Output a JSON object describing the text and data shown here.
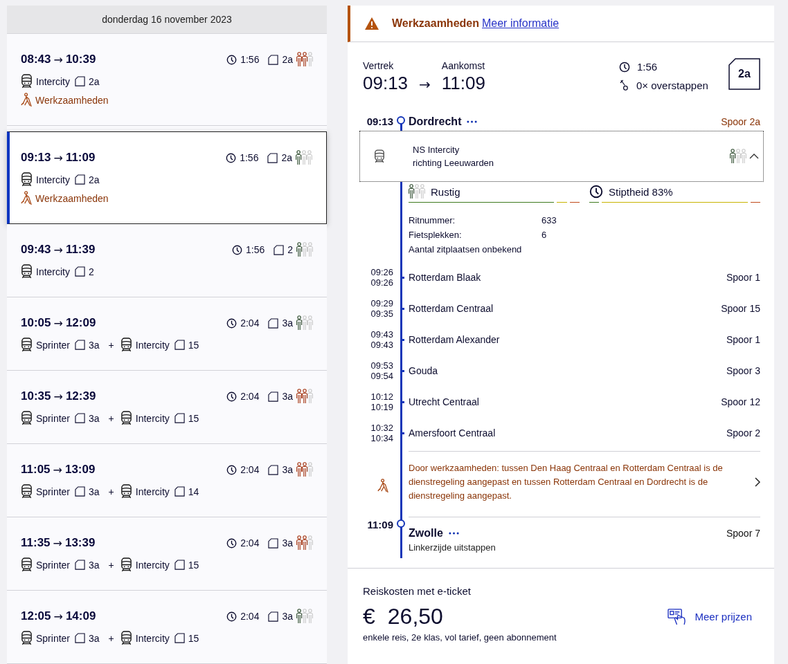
{
  "date_header": "donderdag 16 november 2023",
  "trips": [
    {
      "depart": "08:43",
      "arrow": "→",
      "arrive": "10:39",
      "selected": false,
      "duration": "1:56",
      "platform": "2a",
      "busy": true,
      "legs": [
        {
          "type": "Intercity",
          "platform": "2a"
        }
      ],
      "notice": "Werkzaamheden"
    },
    {
      "depart": "09:13",
      "arrow": "→",
      "arrive": "11:09",
      "selected": true,
      "duration": "1:56",
      "platform": "2a",
      "busy": false,
      "legs": [
        {
          "type": "Intercity",
          "platform": "2a"
        }
      ],
      "notice": "Werkzaamheden"
    },
    {
      "depart": "09:43",
      "arrow": "→",
      "arrive": "11:39",
      "selected": false,
      "duration": "1:56",
      "platform": "2",
      "busy": false,
      "legs": [
        {
          "type": "Intercity",
          "platform": "2"
        }
      ]
    },
    {
      "depart": "10:05",
      "arrow": "→",
      "arrive": "12:09",
      "selected": false,
      "duration": "2:04",
      "platform": "3a",
      "busy": false,
      "leg_separator": "+",
      "legs": [
        {
          "type": "Sprinter",
          "platform": "3a"
        },
        {
          "type": "Intercity",
          "platform": "15"
        }
      ]
    },
    {
      "depart": "10:35",
      "arrow": "→",
      "arrive": "12:39",
      "selected": false,
      "duration": "2:04",
      "platform": "3a",
      "busy": true,
      "leg_separator": "+",
      "legs": [
        {
          "type": "Sprinter",
          "platform": "3a"
        },
        {
          "type": "Intercity",
          "platform": "15"
        }
      ]
    },
    {
      "depart": "11:05",
      "arrow": "→",
      "arrive": "13:09",
      "selected": false,
      "duration": "2:04",
      "platform": "3a",
      "busy": true,
      "leg_separator": "+",
      "legs": [
        {
          "type": "Sprinter",
          "platform": "3a"
        },
        {
          "type": "Intercity",
          "platform": "14"
        }
      ]
    },
    {
      "depart": "11:35",
      "arrow": "→",
      "arrive": "13:39",
      "selected": false,
      "duration": "2:04",
      "platform": "3a",
      "busy": true,
      "leg_separator": "+",
      "legs": [
        {
          "type": "Sprinter",
          "platform": "3a"
        },
        {
          "type": "Intercity",
          "platform": "15"
        }
      ]
    },
    {
      "depart": "12:05",
      "arrow": "→",
      "arrive": "14:09",
      "selected": false,
      "duration": "2:04",
      "platform": "3a",
      "busy": false,
      "leg_separator": "+",
      "legs": [
        {
          "type": "Sprinter",
          "platform": "3a"
        },
        {
          "type": "Intercity",
          "platform": "15"
        }
      ]
    }
  ],
  "detail": {
    "alert": {
      "title": "Werkzaamheden",
      "link": "Meer informatie"
    },
    "summary": {
      "depart_label": "Vertrek",
      "arrive_label": "Aankomst",
      "depart": "09:13",
      "arrow": "→",
      "arrive": "11:09",
      "duration": "1:56",
      "transfers": "0× overstappen",
      "platform": "2a"
    },
    "start": {
      "time": "09:13",
      "station": "Dordrecht",
      "platform": "Spoor 2a",
      "platform_changed": true
    },
    "train": {
      "name": "NS Intercity",
      "direction": "richting Leeuwarden",
      "busy": false,
      "expanded": true
    },
    "indicators": [
      {
        "kind": "crowding",
        "label": "Rustig",
        "busy": false
      },
      {
        "kind": "punctuality",
        "label": "Stiptheid 83%"
      }
    ],
    "facts": [
      {
        "label": "Ritnummer:",
        "value": "633"
      },
      {
        "label": "Fietsplekken:",
        "value": "6"
      }
    ],
    "seats_note": "Aantal zitplaatsen onbekend",
    "stops": [
      {
        "arrive": "09:26",
        "depart": "09:26",
        "station": "Rotterdam Blaak",
        "platform": "Spoor 1"
      },
      {
        "arrive": "09:29",
        "depart": "09:35",
        "station": "Rotterdam Centraal",
        "platform": "Spoor 15"
      },
      {
        "arrive": "09:43",
        "depart": "09:43",
        "station": "Rotterdam Alexander",
        "platform": "Spoor 1"
      },
      {
        "arrive": "09:53",
        "depart": "09:54",
        "station": "Gouda",
        "platform": "Spoor 3"
      },
      {
        "arrive": "10:12",
        "depart": "10:19",
        "station": "Utrecht Centraal",
        "platform": "Spoor 12"
      },
      {
        "arrive": "10:32",
        "depart": "10:34",
        "station": "Amersfoort Centraal",
        "platform": "Spoor 2"
      }
    ],
    "disruption": "Door werkzaamheden: tussen Den Haag Centraal en Rotterdam Centraal is de dienstregeling aangepast en tussen Rotterdam Centraal en Dordrecht is de dienstregeling aangepast.",
    "end": {
      "time": "11:09",
      "station": "Zwolle",
      "platform": "Spoor 7",
      "platform_changed": false,
      "note": "Linkerzijde uitstappen"
    },
    "price": {
      "label": "Reiskosten met e-ticket",
      "currency": "€",
      "amount": "26,50",
      "details": "enkele reis, 2e klas, vol tarief, geen abonnement",
      "more": "Meer prijzen"
    }
  }
}
